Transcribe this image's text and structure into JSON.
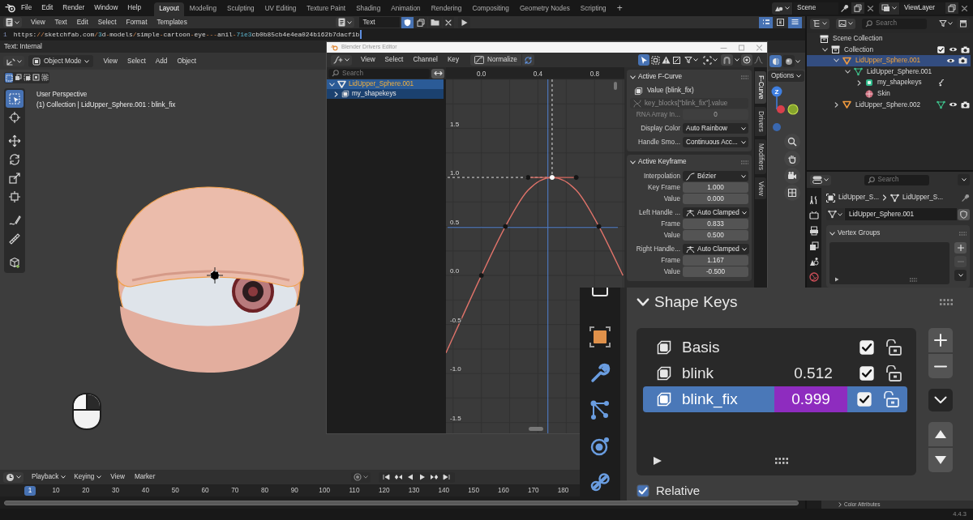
{
  "topbar": {
    "menus": [
      "File",
      "Edit",
      "Render",
      "Window",
      "Help"
    ],
    "workspaces": [
      {
        "label": "Layout",
        "selected": true
      },
      {
        "label": "Modeling",
        "selected": false
      },
      {
        "label": "Sculpting",
        "selected": false
      },
      {
        "label": "UV Editing",
        "selected": false
      },
      {
        "label": "Texture Paint",
        "selected": false
      },
      {
        "label": "Shading",
        "selected": false
      },
      {
        "label": "Animation",
        "selected": false
      },
      {
        "label": "Rendering",
        "selected": false
      },
      {
        "label": "Compositing",
        "selected": false
      },
      {
        "label": "Geometry Nodes",
        "selected": false
      },
      {
        "label": "Scripting",
        "selected": false
      }
    ],
    "add_workspace": "+",
    "scene": "Scene",
    "view_layer": "ViewLayer"
  },
  "text_editor": {
    "menus": [
      "View",
      "Text",
      "Edit",
      "Select",
      "Format",
      "Templates"
    ],
    "datablock": "Text",
    "fake_user": true,
    "display_toggles": [
      {
        "on": true
      },
      {
        "on": false
      },
      {
        "on": true
      }
    ],
    "line_number": "1",
    "line": "https://sketchfab.com/3d-models/simple-cartoon-eye---anil-71e3cb0b85cb4e4ea024b162b7dacf1b",
    "footer": "Text: Internal"
  },
  "viewport": {
    "mode": "Object Mode",
    "menus": [
      "View",
      "Select",
      "Add",
      "Object"
    ],
    "shading_modes": [
      {
        "selected": true
      },
      {
        "selected": false
      }
    ],
    "select_modes": [
      {
        "selected": true
      },
      {
        "selected": false
      },
      {
        "selected": false
      },
      {
        "selected": false
      },
      {
        "selected": false
      }
    ],
    "tools": [
      {
        "selected": true
      },
      {
        "selected": false
      },
      {
        "selected": false
      },
      {
        "selected": false
      },
      {
        "selected": false
      },
      {
        "selected": false
      },
      {
        "selected": false
      },
      {
        "selected": false
      },
      {
        "selected": false
      }
    ],
    "view_name": "User Perspective",
    "info": "(1) Collection | LidUpper_Sphere.001 : blink_fix",
    "options": "Options",
    "gizmo_axis": "Z"
  },
  "drivers_editor": {
    "title": "Blender Drivers Editor",
    "menus": [
      "View",
      "Select",
      "Channel",
      "Key"
    ],
    "normalize": {
      "label": "Normalize",
      "on": false
    },
    "only_selected": true,
    "search": {
      "placeholder": "Search"
    },
    "channels": [
      {
        "name": "LidUpper_Sphere.001",
        "kind": "object",
        "selected": true,
        "expanded": true,
        "children": [
          {
            "name": "my_shapekeys",
            "kind": "shape_keys",
            "selected": true,
            "expanded": false
          }
        ]
      }
    ],
    "chart_data": {
      "type": "line",
      "x": [
        -0.25,
        0,
        0.17,
        0.33,
        0.5,
        0.67,
        0.83,
        1
      ],
      "series": [
        {
          "color": "#e0736a",
          "values": [
            -0.79,
            0,
            0.5,
            0.87,
            1,
            0.87,
            0.5,
            0
          ]
        },
        {
          "type": "line",
          "color": "#d86a60",
          "values": [
            null,
            null,
            null,
            1,
            1,
            1,
            null,
            null
          ]
        },
        {
          "type": "scatter",
          "color": "#151515",
          "values": [
            null,
            0,
            0.5,
            1,
            null,
            1,
            0.5,
            null
          ]
        },
        {
          "type": "scatter",
          "color": "#ffffff",
          "values": [
            null,
            null,
            null,
            null,
            1,
            null,
            null,
            null
          ]
        }
      ],
      "xlim": [
        -0.25,
        1.01
      ],
      "ylim": [
        -1.61,
        2
      ],
      "xticks": [
        {
          "value": 0,
          "label": "0.0"
        },
        {
          "value": 0.4,
          "label": "0.4"
        },
        {
          "value": 0.8,
          "label": "0.8"
        }
      ],
      "yticks": [
        {
          "value": 1.5,
          "label": "1.5"
        },
        {
          "value": 1,
          "label": "1.0"
        },
        {
          "value": 0.5,
          "label": "0.5"
        },
        {
          "value": 0,
          "label": "0.0"
        },
        {
          "value": -0.5,
          "label": "-0.5"
        },
        {
          "value": -1,
          "label": "-1.0"
        },
        {
          "value": -1.5,
          "label": "-1.5"
        }
      ],
      "grid": true,
      "ref_lines": [
        {
          "axis": "x",
          "value": 0.47,
          "color": "#4f7fd0"
        },
        {
          "axis": "y",
          "value": 0.49,
          "color": "#4f7fd0"
        },
        {
          "axis": "x",
          "value": 0.5,
          "color": "#e0e0e0"
        },
        {
          "axis": "y",
          "value": 1,
          "color": "#e0e0e0"
        }
      ]
    },
    "fcurve_panel": {
      "title": "Active F-Curve",
      "expanded": true,
      "channel": "Value (blink_fix)",
      "path": "key_blocks[\"blink_fix\"].value",
      "rows": [
        {
          "label": "RNA Array In...",
          "value": "0",
          "kind": "field",
          "disabled": true
        },
        {
          "label": "Display Color",
          "value": "Auto Rainbow",
          "kind": "dropdown",
          "disabled": false
        },
        {
          "label": "Handle Smo...",
          "value": "Continuous Acc...",
          "kind": "dropdown",
          "disabled": false
        }
      ]
    },
    "keyframe_panel": {
      "title": "Active Keyframe",
      "expanded": true,
      "rows": [
        {
          "label": "Interpolation",
          "value": "Bézier",
          "kind": "interp_dropdown"
        },
        {
          "label": "Key Frame",
          "value": "1.000",
          "kind": "field"
        },
        {
          "label": "Value",
          "value": "0.000",
          "kind": "field"
        },
        {
          "label": "Left Handle ...",
          "value": "Auto Clamped",
          "kind": "handle_dropdown"
        },
        {
          "label": "Frame",
          "value": "0.833",
          "kind": "field"
        },
        {
          "label": "Value",
          "value": "0.500",
          "kind": "field"
        },
        {
          "label": "Right Handle...",
          "value": "Auto Clamped",
          "kind": "handle_dropdown"
        },
        {
          "label": "Frame",
          "value": "1.167",
          "kind": "field"
        },
        {
          "label": "Value",
          "value": "-0.500",
          "kind": "field"
        }
      ]
    },
    "tabs": [
      {
        "label": "F-Curve",
        "selected": true
      },
      {
        "label": "Drivers",
        "selected": false
      },
      {
        "label": "Modifiers",
        "selected": false
      },
      {
        "label": "View",
        "selected": false
      }
    ]
  },
  "outliner": {
    "search": {
      "placeholder": "Search"
    },
    "tree": [
      {
        "name": "Scene Collection",
        "kind": "scene_collection",
        "selected": false,
        "children": [
          {
            "name": "Collection",
            "kind": "collection",
            "selected": false,
            "expanded": true,
            "checked": true,
            "visible": true,
            "children": [
              {
                "name": "LidUpper_Sphere.001",
                "kind": "object",
                "selected": true,
                "expanded": true,
                "visible": true,
                "children": [
                  {
                    "name": "LidUpper_Sphere.001",
                    "kind": "mesh",
                    "selected": false,
                    "expanded": true,
                    "children": [
                      {
                        "name": "my_shapekeys",
                        "kind": "shape_keys",
                        "selected": false,
                        "expanded": false,
                        "inline_children": [
                          {
                            "kind": "driver"
                          }
                        ]
                      },
                      {
                        "name": "Skin",
                        "kind": "material",
                        "selected": false
                      }
                    ]
                  }
                ]
              },
              {
                "name": "LidUpper_Sphere.002",
                "kind": "object",
                "selected": false,
                "expanded": false,
                "visible": true,
                "inline_children": [
                  {
                    "kind": "mesh"
                  }
                ]
              }
            ]
          }
        ]
      }
    ]
  },
  "properties": {
    "search": {
      "placeholder": "Search"
    },
    "breadcrumb": [
      "LidUpper_S...",
      "LidUpper_S..."
    ],
    "mesh_name": "LidUpper_Sphere.001",
    "fake_user": false,
    "vertex_groups": {
      "title": "Vertex Groups",
      "expanded": true
    },
    "color_attributes": {
      "title": "Color Attributes",
      "expanded": false
    }
  },
  "shape_keys": {
    "title": "Shape Keys",
    "expanded": true,
    "keys": [
      {
        "name": "Basis",
        "selected": false,
        "checked": true
      },
      {
        "name": "blink",
        "value": "0.512",
        "selected": false,
        "checked": true,
        "driven": false
      },
      {
        "name": "blink_fix",
        "value": "0.999",
        "selected": true,
        "checked": true,
        "driven": true
      }
    ],
    "relative": {
      "label": "Relative",
      "checked": true
    }
  },
  "timeline": {
    "menus": [
      {
        "label": "Playback",
        "kind": "dropdown"
      },
      {
        "label": "Keying",
        "kind": "dropdown"
      },
      {
        "label": "View",
        "kind": "menu"
      },
      {
        "label": "Marker",
        "kind": "menu"
      }
    ],
    "current_frame": "1",
    "frames": [
      "10",
      "20",
      "30",
      "40",
      "50",
      "60",
      "70",
      "80",
      "90",
      "100",
      "110",
      "120",
      "130",
      "140",
      "150",
      "160",
      "170",
      "180"
    ]
  },
  "status_bar": {
    "version": "4.4.3"
  }
}
